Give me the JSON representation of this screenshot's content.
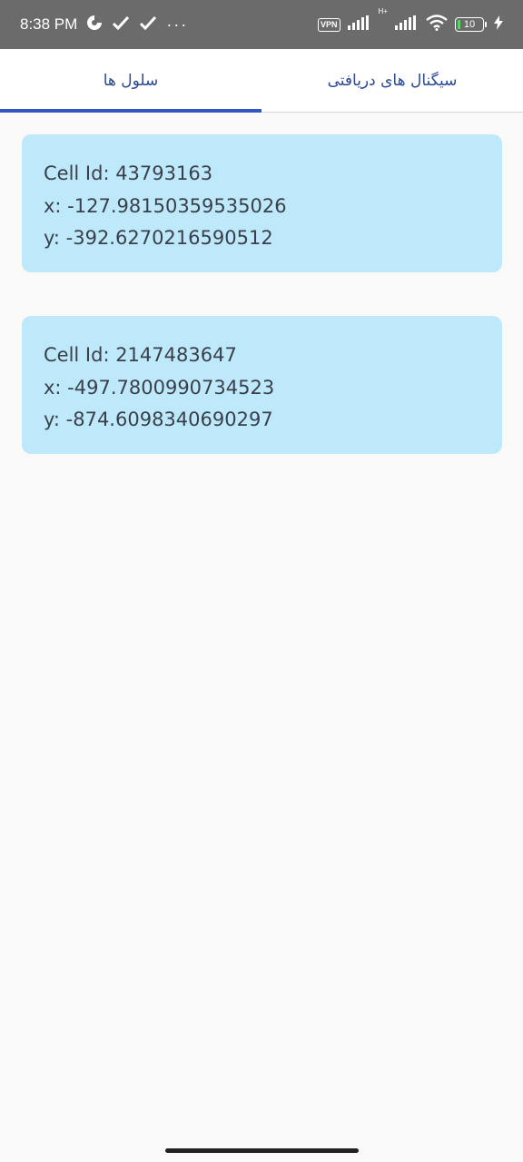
{
  "status_bar": {
    "time": "8:38 PM",
    "dots": "···",
    "vpn": "VPN",
    "battery": "10",
    "network_label": "H+"
  },
  "tabs": [
    {
      "label": "سیگنال های دریافتی",
      "active": false
    },
    {
      "label": "سلول ها",
      "active": true
    }
  ],
  "cells": [
    {
      "cell_id": "Cell Id: 43793163",
      "x": "x: -127.98150359535026",
      "y": "y: -392.6270216590512"
    },
    {
      "cell_id": "Cell Id: 2147483647",
      "x": "x: -497.7800990734523",
      "y": "y: -874.6098340690297"
    }
  ],
  "colors": {
    "accent": "#2f56c2",
    "card": "#bde9fb",
    "status_bar": "#6b6b6b"
  }
}
